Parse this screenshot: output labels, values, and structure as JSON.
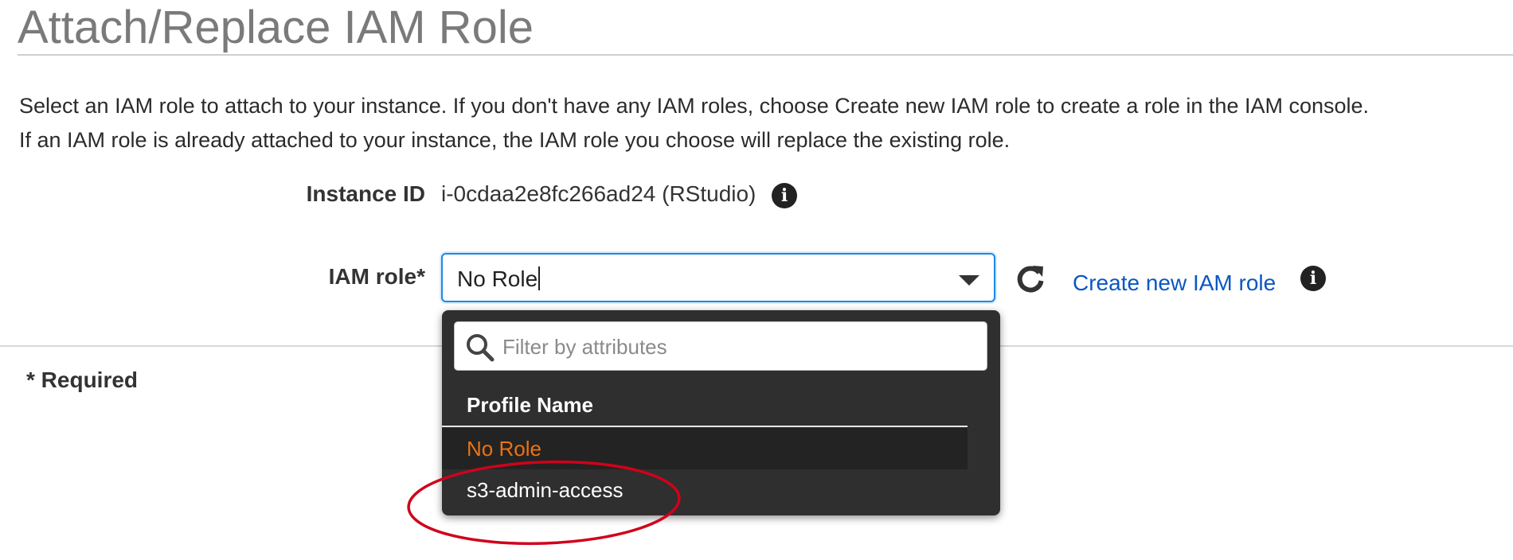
{
  "page": {
    "title": "Attach/Replace IAM Role",
    "description_lines": [
      "Select an IAM role to attach to your instance. If you don't have any IAM roles, choose Create new IAM role to create a role in the IAM console.",
      "If an IAM role is already attached to your instance, the IAM role you choose will replace the existing role."
    ]
  },
  "form": {
    "instance_id_label": "Instance ID",
    "instance_id_value": "i-0cdaa2e8fc266ad24 (RStudio)",
    "iam_role_label": "IAM role*",
    "iam_role_value": "No Role",
    "create_link": "Create new IAM role",
    "required_note": "* Required"
  },
  "dropdown": {
    "filter_placeholder": "Filter by attributes",
    "column_header": "Profile Name",
    "options": [
      {
        "label": "No Role",
        "selected": true
      },
      {
        "label": "s3-admin-access",
        "selected": false
      }
    ]
  },
  "icons": {
    "info": "info-icon",
    "refresh": "refresh-icon",
    "search": "search-icon",
    "dropdown": "chevron-down-icon"
  },
  "colors": {
    "link": "#0a57c2",
    "focus_border": "#1e88e5",
    "selected_option": "#ec7211",
    "annotation_circle": "#d0021b",
    "dropdown_bg": "#2f2f2f"
  }
}
